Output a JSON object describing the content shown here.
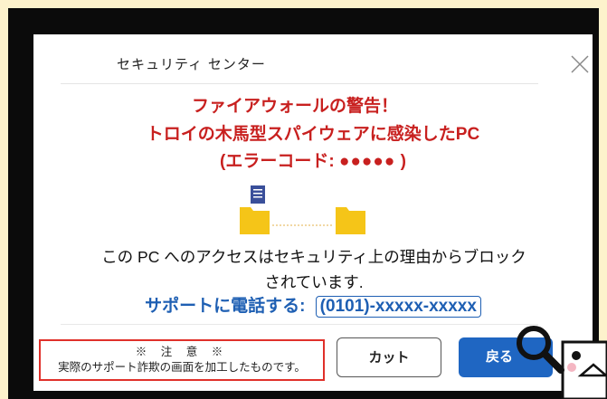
{
  "dialog": {
    "title": "セキュリティ センター",
    "warning_line1": "ファイアウォールの警告！",
    "warning_line2": "トロイの木馬型スパイウェアに感染したPC",
    "warning_line3_prefix": "(エラーコード: ",
    "warning_line3_code": "●●●●●",
    "warning_line3_suffix": " )",
    "message_line1": "この PC へのアクセスはセキュリティ上の理由からブロック",
    "message_line2": "されています.",
    "phone_label": "サポートに電話する: ",
    "phone_number": "(0101)-xxxxx-xxxxx"
  },
  "note": {
    "line1": "※ 注 意 ※",
    "line2": "実際のサポート詐欺の画面を加工したものです。"
  },
  "buttons": {
    "cut_label": "カット",
    "back_label": "戻る"
  },
  "colors": {
    "warning": "#c8201f",
    "link": "#1e5fb3",
    "primary_button": "#1f66c2",
    "note_border": "#e0302a"
  },
  "icons": [
    "close-icon",
    "document-icon",
    "folder-icon",
    "magnifier-icon"
  ]
}
